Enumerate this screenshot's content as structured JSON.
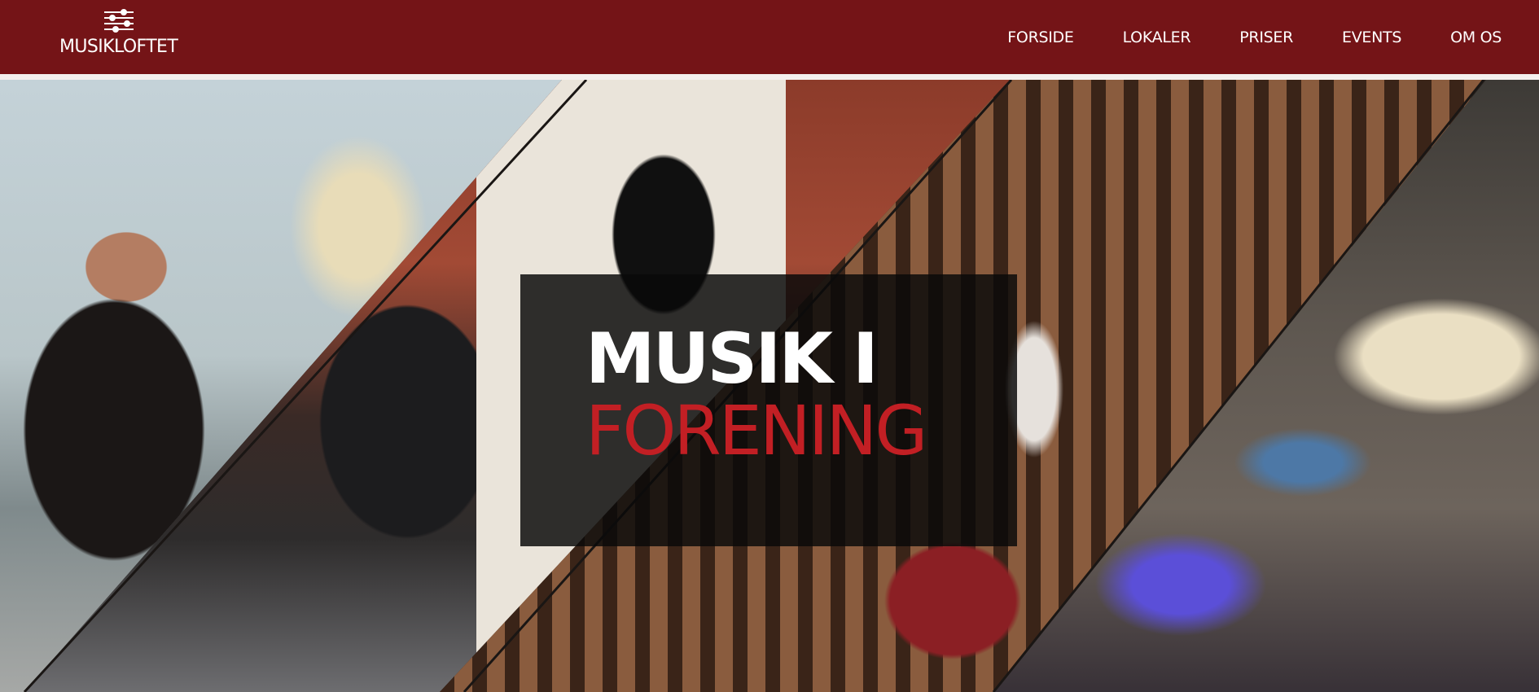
{
  "brand": {
    "name": "MUSIKLOFTET",
    "logo_icon": "equalizer-sliders-icon"
  },
  "nav": {
    "items": [
      "FORSIDE",
      "LOKALER",
      "PRISER",
      "EVENTS",
      "OM OS"
    ]
  },
  "hero": {
    "title_line1": "MUSIK I",
    "title_line2": "FORENING",
    "images": [
      "bass-player-with-microphone",
      "amplifiers-and-portrait-poster",
      "drummer-with-red-drum-kit",
      "guitar-and-effect-pedals"
    ]
  },
  "colors": {
    "header_background": "#741417",
    "accent_red": "#c21f24",
    "text_white": "#ffffff",
    "overlay_black": "#0a0a0a"
  }
}
